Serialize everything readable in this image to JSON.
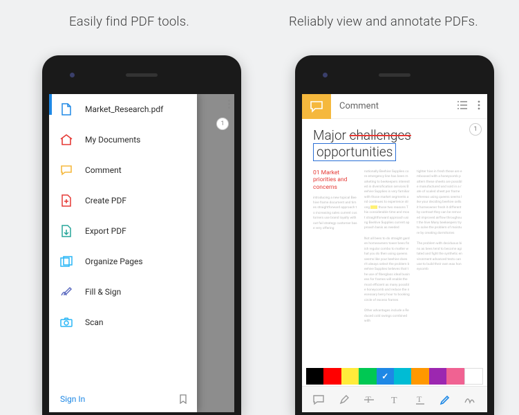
{
  "captions": {
    "left": "Easily find PDF tools.",
    "right": "Reliably view and annotate PDFs."
  },
  "left_screen": {
    "page_badge": "1",
    "drawer": {
      "items": [
        {
          "label": "Market_Research.pdf",
          "icon": "file-icon"
        },
        {
          "label": "My Documents",
          "icon": "home-icon"
        },
        {
          "label": "Comment",
          "icon": "comment-icon"
        },
        {
          "label": "Create PDF",
          "icon": "create-pdf-icon"
        },
        {
          "label": "Export PDF",
          "icon": "export-pdf-icon"
        },
        {
          "label": "Organize Pages",
          "icon": "organize-pages-icon"
        },
        {
          "label": "Fill & Sign",
          "icon": "fill-sign-icon"
        },
        {
          "label": "Scan",
          "icon": "camera-icon"
        }
      ],
      "footer": {
        "signin": "Sign In"
      }
    }
  },
  "right_screen": {
    "topbar": {
      "title": "Comment"
    },
    "page_badge": "1",
    "doc": {
      "title_prefix": "Major ",
      "title_struck": "challenges",
      "title_inserted": "opportunities",
      "subhead": "01 Market priorities and concerns"
    },
    "colors": [
      "#000000",
      "#ff0000",
      "#ffeb3b",
      "#00c853",
      "#1e88e5",
      "#00bcd4",
      "#ff9800",
      "#9c27b0",
      "#f06292",
      "#ffffff"
    ],
    "selected_color_index": 4,
    "tools": [
      "comment",
      "highlight",
      "strike",
      "text-add",
      "text-underline",
      "draw",
      "erase"
    ]
  }
}
